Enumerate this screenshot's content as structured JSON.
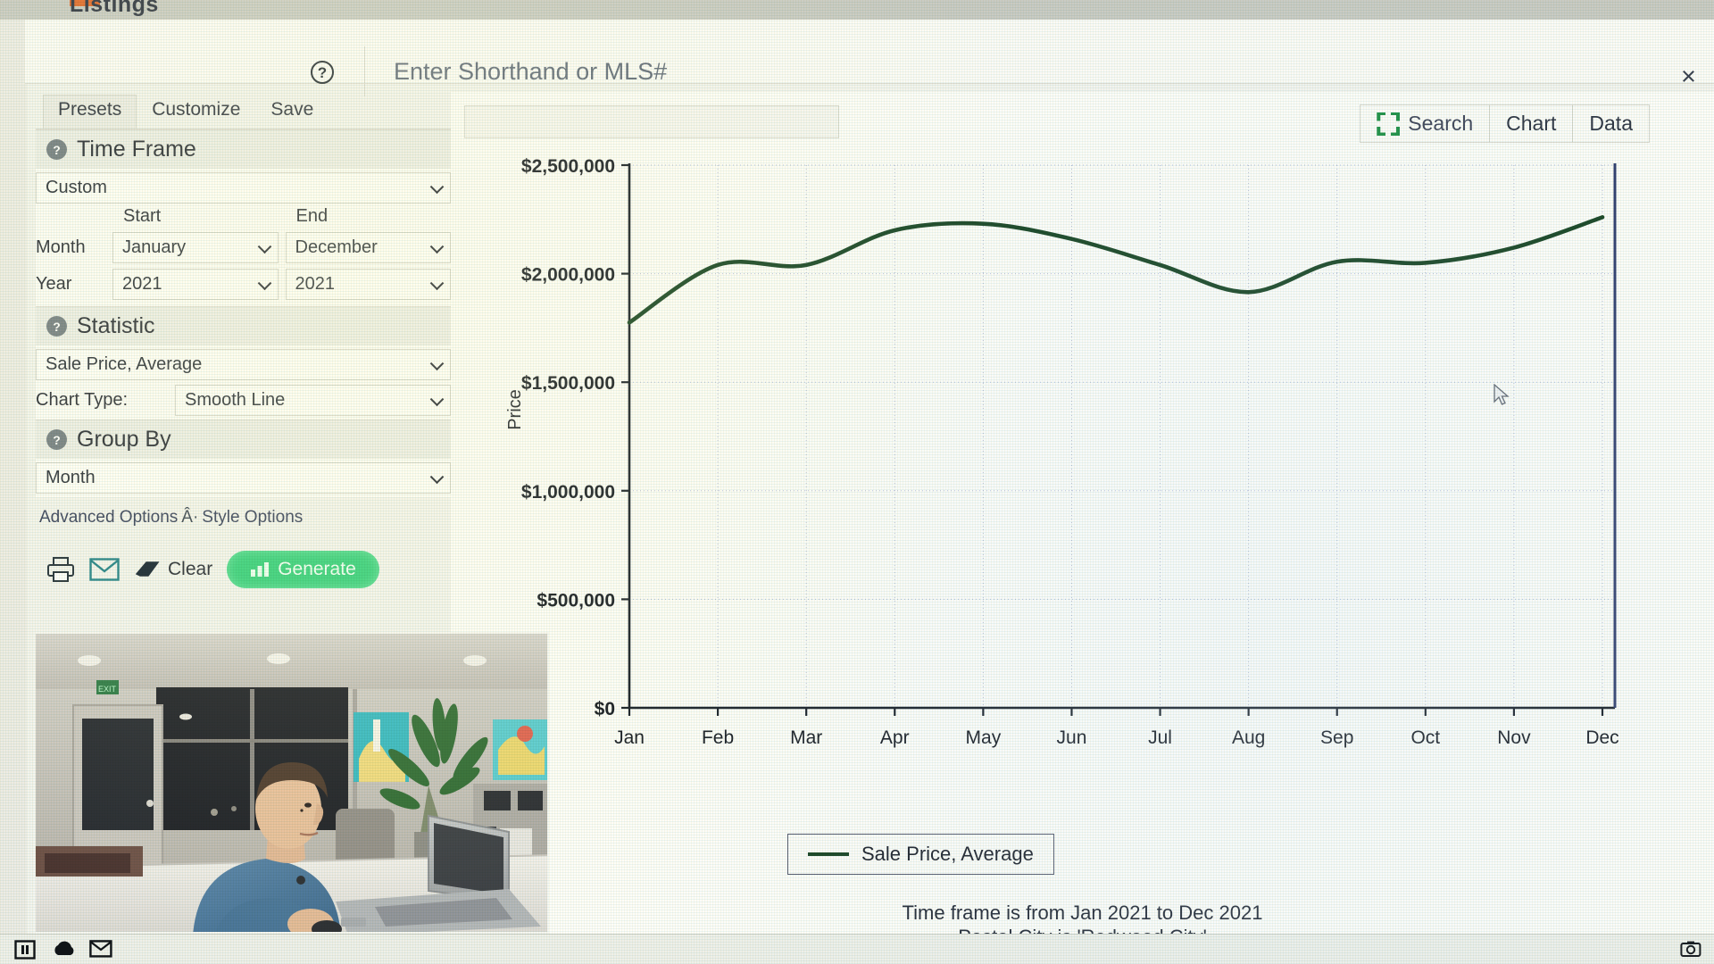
{
  "window": {
    "title": "Listings"
  },
  "searchbar": {
    "help_icon": "question-circle-icon",
    "placeholder": "Enter Shorthand or MLS#",
    "value": "",
    "close_label": "×"
  },
  "panel": {
    "tabs": [
      {
        "label": "Presets",
        "active": true
      },
      {
        "label": "Customize",
        "active": false
      },
      {
        "label": "Save",
        "active": false
      }
    ],
    "time_frame": {
      "heading": "Time Frame",
      "preset": "Custom",
      "col_start": "Start",
      "col_end": "End",
      "row_month": "Month",
      "row_year": "Year",
      "start_month": "January",
      "end_month": "December",
      "start_year": "2021",
      "end_year": "2021"
    },
    "statistic": {
      "heading": "Statistic",
      "value": "Sale Price, Average",
      "chart_type_label": "Chart Type:",
      "chart_type_value": "Smooth Line"
    },
    "group_by": {
      "heading": "Group By",
      "value": "Month"
    },
    "links": {
      "advanced": "Advanced Options",
      "separator": "Â·",
      "style": "Style Options"
    },
    "actions": {
      "print": "printer-icon",
      "email": "envelope-icon",
      "clear": "Clear",
      "generate": "Generate"
    }
  },
  "chart_header": {
    "tabs": [
      {
        "label": "Search",
        "icon": "expand-arrows-icon"
      },
      {
        "label": "Chart",
        "icon": ""
      },
      {
        "label": "Data",
        "icon": ""
      }
    ]
  },
  "footnotes": {
    "line1": "Time frame is from Jan 2021 to Dec 2021",
    "line2": "Postal City is 'Redwood City'"
  },
  "taskbar": {
    "left_icons": [
      "pause-icon",
      "cloud-icon",
      "envelope-icon"
    ],
    "right_icons": [
      "camera-icon"
    ]
  },
  "colors": {
    "line": "#13421f",
    "generate": "#2fcf79",
    "accent_green": "#1b8f43"
  },
  "chart_data": {
    "type": "line",
    "title": "",
    "xlabel": "",
    "ylabel": "Price",
    "categories": [
      "Jan",
      "Feb",
      "Mar",
      "Apr",
      "May",
      "Jun",
      "Jul",
      "Aug",
      "Sep",
      "Oct",
      "Nov",
      "Dec"
    ],
    "series": [
      {
        "name": "Sale Price, Average",
        "color": "#13421f",
        "values": [
          1775000,
          2040000,
          2040000,
          2200000,
          2230000,
          2160000,
          2040000,
          1915000,
          2055000,
          2050000,
          2120000,
          2260000
        ]
      }
    ],
    "ylim": [
      0,
      2500000
    ],
    "ytick_values": [
      0,
      500000,
      1000000,
      1500000,
      2000000,
      2500000
    ],
    "ytick_labels": [
      "$0",
      "$500,000",
      "$1,000,000",
      "$1,500,000",
      "$2,000,000",
      "$2,500,000"
    ],
    "grid": true,
    "legend": {
      "position": "bottom",
      "entries": [
        "Sale Price, Average"
      ]
    },
    "smooth": true
  }
}
